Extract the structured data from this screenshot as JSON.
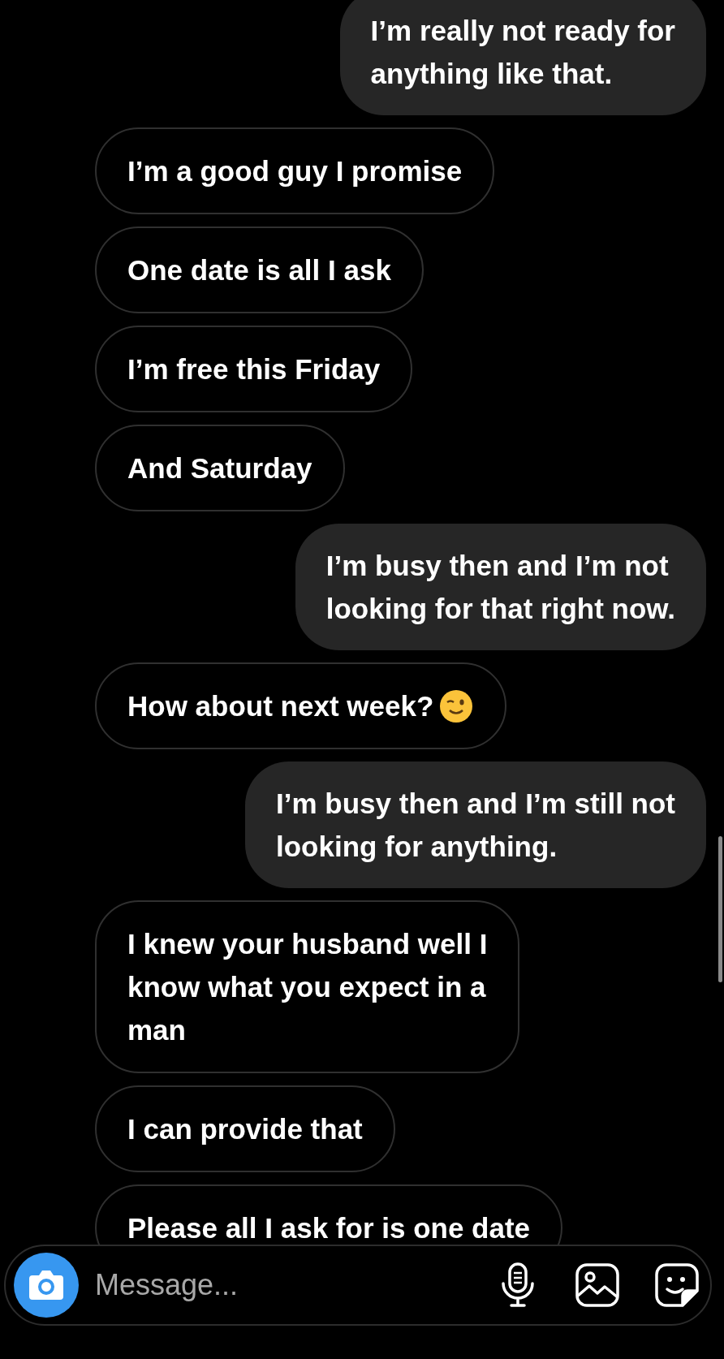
{
  "messages": [
    {
      "kind": "sent",
      "text": "I’m really not ready for\nanything like that."
    },
    {
      "kind": "received",
      "text": "I’m a good guy I promise"
    },
    {
      "kind": "received",
      "text": "One date is all I ask"
    },
    {
      "kind": "received",
      "text": "I’m free this Friday"
    },
    {
      "kind": "received",
      "text": "And Saturday"
    },
    {
      "kind": "sent",
      "text": "I’m busy then and I’m not\nlooking for that right now."
    },
    {
      "kind": "received",
      "text": "How about next week?",
      "has_emoji": true
    },
    {
      "kind": "sent",
      "text": "I’m busy then and I’m still not\nlooking for anything."
    },
    {
      "kind": "received",
      "text": "I knew your husband well I\nknow what you expect in a\nman"
    },
    {
      "kind": "received",
      "text": "I can provide that"
    },
    {
      "kind": "received",
      "text": "Please all I ask for is one date"
    }
  ],
  "composer": {
    "placeholder": "Message..."
  }
}
